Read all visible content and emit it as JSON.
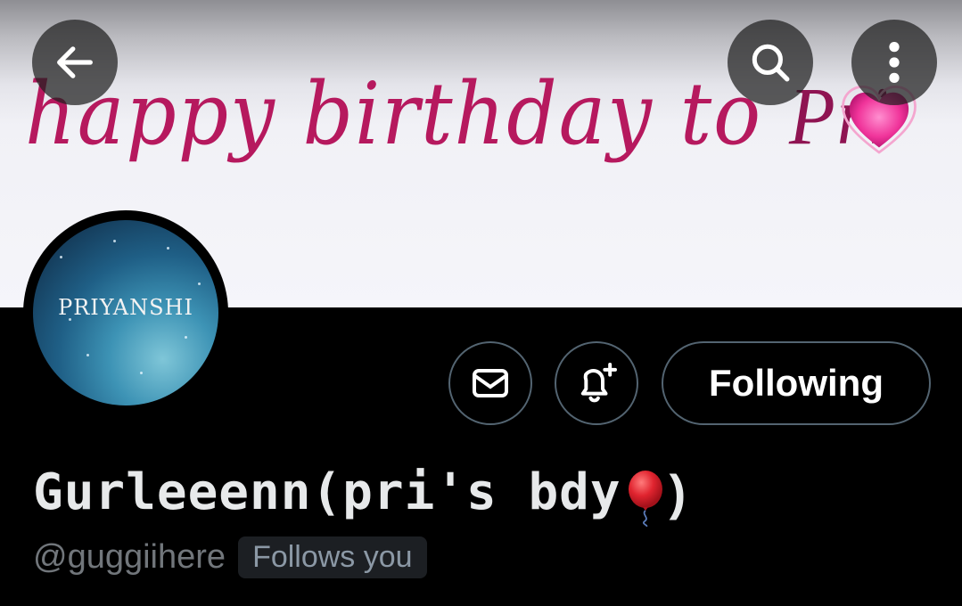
{
  "header": {
    "banner_text": "happy birthday to ",
    "banner_text_name": "Pri"
  },
  "avatar": {
    "label": "PRIYANSHI"
  },
  "actions": {
    "following_label": "Following"
  },
  "profile": {
    "display_name_prefix": "Gurleeenn(pri's bdy",
    "display_name_suffix": ")",
    "handle": "@guggiihere",
    "follows_you": "Follows you"
  },
  "icons": {
    "back": "arrow-left-icon",
    "search": "search-icon",
    "more": "more-vertical-icon",
    "mail": "mail-icon",
    "bell": "bell-plus-icon",
    "heart": "heart-icon",
    "balloon": "balloon-icon"
  },
  "colors": {
    "banner_text": "#b6195e",
    "border": "#536471",
    "handle": "#71767b"
  }
}
